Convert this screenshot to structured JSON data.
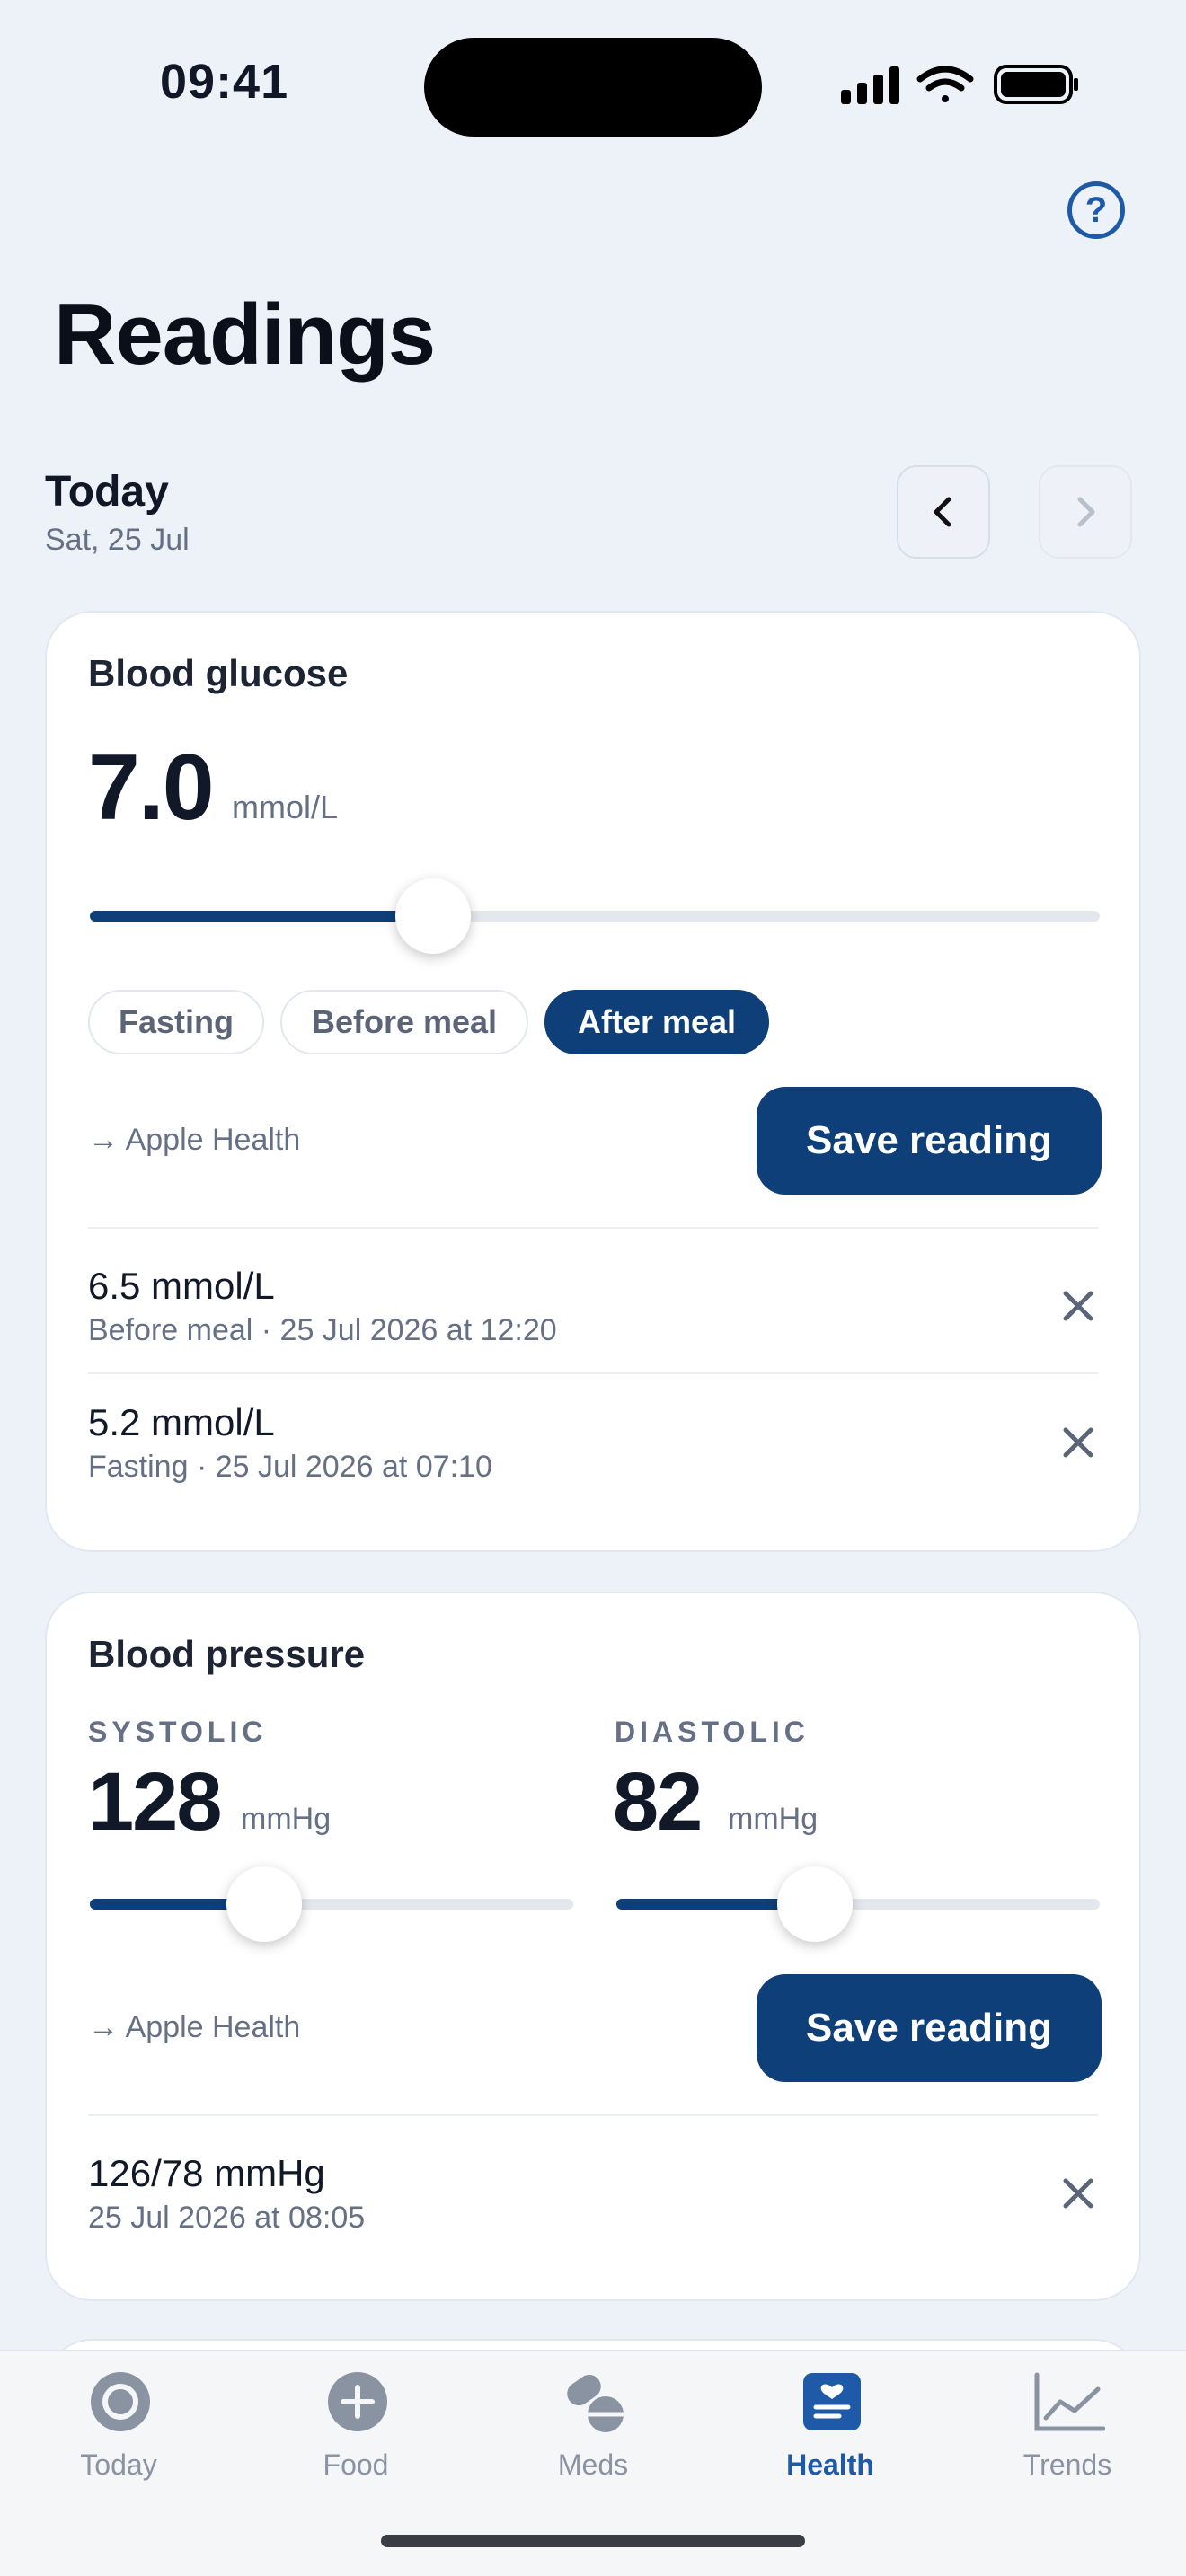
{
  "status_bar": {
    "time": "09:41"
  },
  "page": {
    "title": "Readings"
  },
  "date_header": {
    "title": "Today",
    "subtitle": "Sat, 25 Jul"
  },
  "glucose": {
    "title": "Blood glucose",
    "value": "7.0",
    "unit": "mmol/L",
    "slider_fraction": 0.34,
    "chips": [
      "Fasting",
      "Before meal",
      "After meal"
    ],
    "selected_chip": "After meal",
    "health_link": "→ Apple Health",
    "save_label": "Save reading",
    "entries": [
      {
        "value": "6.5 mmol/L",
        "meta": "Before meal · 25 Jul 2026 at 12:20"
      },
      {
        "value": "5.2 mmol/L",
        "meta": "Fasting · 25 Jul 2026 at 07:10"
      }
    ]
  },
  "pressure": {
    "title": "Blood pressure",
    "systolic": {
      "label": "SYSTOLIC",
      "value": "128",
      "unit": "mmHg",
      "slider_fraction": 0.36
    },
    "diastolic": {
      "label": "DIASTOLIC",
      "value": "82",
      "unit": "mmHg",
      "slider_fraction": 0.41
    },
    "health_link": "→ Apple Health",
    "save_label": "Save reading",
    "entries": [
      {
        "value": "126/78 mmHg",
        "meta": "25 Jul 2026 at 08:05"
      }
    ]
  },
  "tabs": [
    {
      "label": "Today",
      "icon": "today-ring-icon"
    },
    {
      "label": "Food",
      "icon": "plus-circle-icon"
    },
    {
      "label": "Meds",
      "icon": "pills-icon"
    },
    {
      "label": "Health",
      "icon": "health-clipboard-icon",
      "active": true
    },
    {
      "label": "Trends",
      "icon": "trend-chart-icon"
    }
  ],
  "colors": {
    "accent": "#0E3F78",
    "tab_active": "#1E5AA8",
    "background": "#EDF2F9"
  }
}
